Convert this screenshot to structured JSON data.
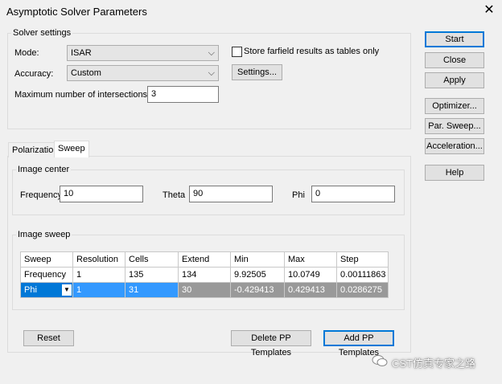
{
  "window": {
    "title": "Asymptotic Solver Parameters"
  },
  "solver_settings": {
    "group_label": "Solver settings",
    "mode_label": "Mode:",
    "mode_value": "ISAR",
    "accuracy_label": "Accuracy:",
    "accuracy_value": "Custom",
    "max_intersections_label": "Maximum number of intersections:",
    "max_intersections_value": "3",
    "store_farfield_label": "Store farfield results as tables only",
    "settings_button": "Settings..."
  },
  "side_buttons": {
    "start": "Start",
    "close": "Close",
    "apply": "Apply",
    "optimizer": "Optimizer...",
    "par_sweep": "Par. Sweep...",
    "acceleration": "Acceleration...",
    "help": "Help"
  },
  "tabs": [
    {
      "label": "Polarization"
    },
    {
      "label": "Sweep"
    }
  ],
  "image_center": {
    "group_label": "Image center",
    "frequency_label": "Frequency",
    "frequency_value": "10",
    "theta_label": "Theta",
    "theta_value": "90",
    "phi_label": "Phi",
    "phi_value": "0"
  },
  "image_sweep": {
    "group_label": "Image sweep",
    "columns": [
      "Sweep",
      "Resolution",
      "Cells",
      "Extend",
      "Min",
      "Max",
      "Step"
    ],
    "rows": [
      [
        "Frequency",
        "1",
        "135",
        "134",
        "9.92505",
        "10.0749",
        "0.00111863"
      ],
      [
        "Phi",
        "1",
        "31",
        "30",
        "-0.429413",
        "0.429413",
        "0.0286275"
      ]
    ]
  },
  "bottom_buttons": {
    "reset": "Reset",
    "delete_pp": "Delete PP Templates",
    "add_pp": "Add PP Templates"
  },
  "watermark": "CST仿真专家之路"
}
